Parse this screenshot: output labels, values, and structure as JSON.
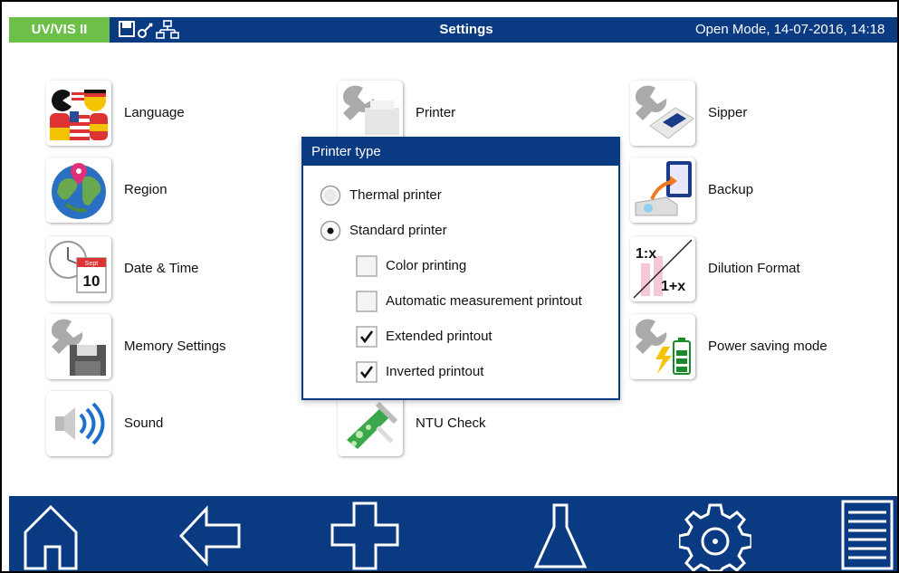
{
  "header": {
    "brand": "UV/VIS II",
    "title": "Settings",
    "status": "Open Mode, 14-07-2016, 14:18",
    "icons": [
      "save-icon",
      "key-icon",
      "network-icon"
    ]
  },
  "colors": {
    "header_blue": "#0a3a82",
    "brand_green": "#6cc04a",
    "tile_shadow": "#999999"
  },
  "settings": {
    "col1": [
      {
        "label": "Language",
        "icon": "language-flags-icon"
      },
      {
        "label": "Region",
        "icon": "globe-icon"
      },
      {
        "label": "Date & Time",
        "icon": "calendar-clock-icon",
        "calendar_month": "Sept",
        "calendar_day": "10"
      },
      {
        "label": "Memory Settings",
        "icon": "floppy-wrench-icon"
      },
      {
        "label": "Sound",
        "icon": "speaker-icon"
      }
    ],
    "col2": [
      {
        "label": "Printer",
        "icon": "printer-wrench-icon"
      },
      {
        "label": "NTU Check",
        "icon": "ntu-check-icon"
      }
    ],
    "col3": [
      {
        "label": "Sipper",
        "icon": "sipper-wrench-icon"
      },
      {
        "label": "Backup",
        "icon": "backup-icon"
      },
      {
        "label": "Dilution Format",
        "icon": "dilution-icon",
        "ratio_top": "1:x",
        "ratio_bottom": "1+x"
      },
      {
        "label": "Power saving mode",
        "icon": "battery-wrench-icon"
      }
    ]
  },
  "dialog": {
    "title": "Printer type",
    "radios": [
      {
        "label": "Thermal printer",
        "selected": false
      },
      {
        "label": "Standard printer",
        "selected": true
      }
    ],
    "checkboxes": [
      {
        "label": "Color printing",
        "checked": false
      },
      {
        "label": "Automatic measurement printout",
        "checked": false
      },
      {
        "label": "Extended printout",
        "checked": true
      },
      {
        "label": "Inverted printout",
        "checked": true
      }
    ]
  },
  "bottom_nav": [
    "home-icon",
    "back-arrow-icon",
    "add-icon",
    "flask-icon",
    "settings-gear-icon",
    "menu-list-icon"
  ]
}
